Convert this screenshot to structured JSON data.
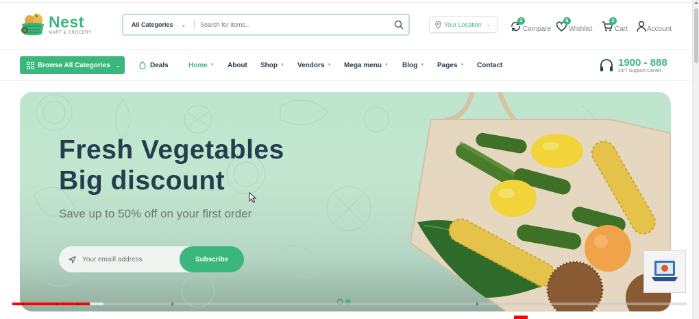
{
  "brand": {
    "name": "Nest",
    "tagline": "MART & GROCERY",
    "color": "#3bb77e",
    "text_color": "#253d4e"
  },
  "search": {
    "category_label": "All Categories",
    "placeholder": "Search for items..."
  },
  "location": {
    "label": "Your Location"
  },
  "header_actions": [
    {
      "label": "Compare",
      "count": "3",
      "icon": "compare-icon"
    },
    {
      "label": "Wishlist",
      "count": "6",
      "icon": "heart-icon"
    },
    {
      "label": "Cart",
      "count": "2",
      "icon": "cart-icon"
    },
    {
      "label": "Account",
      "icon": "user-icon"
    }
  ],
  "nav": {
    "browse_label": "Browse All Categories",
    "items": [
      {
        "label": "Deals",
        "icon": "deals-icon"
      },
      {
        "label": "Home",
        "active": true,
        "dropdown": true
      },
      {
        "label": "About"
      },
      {
        "label": "Shop",
        "dropdown": true
      },
      {
        "label": "Vendors",
        "dropdown": true
      },
      {
        "label": "Mega menu",
        "dropdown": true
      },
      {
        "label": "Blog",
        "dropdown": true
      },
      {
        "label": "Pages",
        "dropdown": true
      },
      {
        "label": "Contact"
      }
    ]
  },
  "support": {
    "phone": "1900 - 888",
    "subtitle": "24/7 Support Center",
    "icon": "headset-icon"
  },
  "hero": {
    "title_line1": "Fresh Vegetables",
    "title_line2": "Big discount",
    "subtitle": "Save up to 50% off on your first order",
    "email_placeholder": "Your emaill address",
    "subscribe_label": "Subscribe",
    "slide_count": 2,
    "active_slide": 2
  },
  "video_progress": {
    "played_fraction": 0.115,
    "buffered_fraction": 0.135
  }
}
